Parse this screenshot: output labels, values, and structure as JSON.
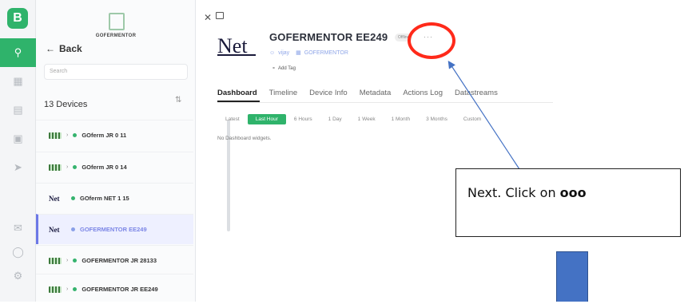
{
  "rail": {
    "logo_letter": "B"
  },
  "panel": {
    "org_name": "GOFERMENTOR",
    "back_label": "Back",
    "search_placeholder": "Search",
    "devices_count": "13 Devices",
    "devices": [
      {
        "name": "GOferm JR 0 11",
        "thumb": "grid",
        "selected": false
      },
      {
        "name": "GOferm JR 0 14",
        "thumb": "grid",
        "selected": false
      },
      {
        "name": "GOferm NET 1 15",
        "thumb": "Net",
        "selected": false
      },
      {
        "name": "GOFERMENTOR EE249",
        "thumb": "Net",
        "selected": true
      },
      {
        "name": "GOFERMENTOR JR 28133",
        "thumb": "grid",
        "selected": false
      },
      {
        "name": "GOFERMENTOR JR EE249",
        "thumb": "grid",
        "selected": false
      }
    ]
  },
  "header": {
    "logo_text": "Net",
    "device_title": "GOFERMENTOR EE249",
    "status": "Offline",
    "more_label": "···",
    "owner": "vijay",
    "org": "GOFERMENTOR",
    "add_tag": "Add Tag"
  },
  "tabs": [
    "Dashboard",
    "Timeline",
    "Device Info",
    "Metadata",
    "Actions Log",
    "Datastreams"
  ],
  "active_tab": "Dashboard",
  "ranges": [
    "Latest",
    "Last Hour",
    "6 Hours",
    "1 Day",
    "1 Week",
    "1 Month",
    "3 Months",
    "Custom"
  ],
  "active_range": "Last Hour",
  "empty_message": "No Dashboard widgets.",
  "annotation": {
    "callout_prefix": "Next. Click on ",
    "callout_bold": "ooo",
    "circle_color": "#ff2a1a",
    "arrow_color": "#4472c4"
  },
  "colors": {
    "accent": "#2fb36b",
    "selected": "#6c78e6"
  }
}
